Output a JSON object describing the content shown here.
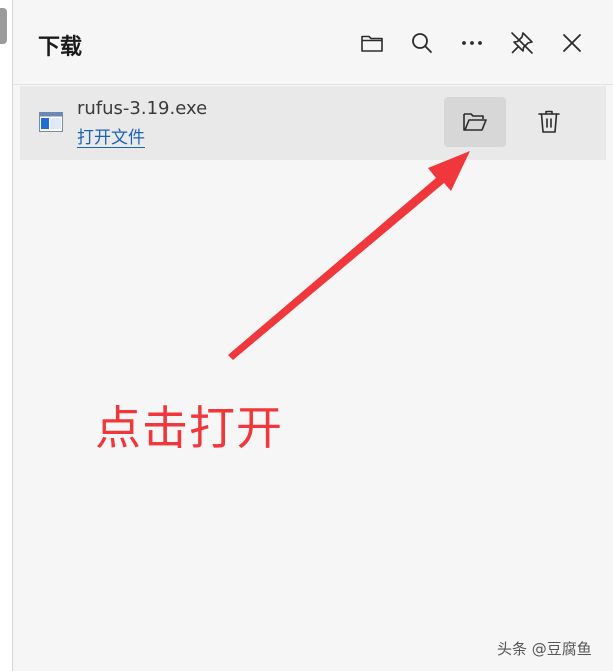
{
  "panel": {
    "title": "下载"
  },
  "header_icons": [
    "folder-icon",
    "search-icon",
    "more-icon",
    "unpin-icon",
    "close-icon"
  ],
  "download_item": {
    "file_name": "rufus-3.19.exe",
    "open_file_label": "打开文件",
    "icons": [
      "exe-file-icon",
      "folder-open-icon",
      "trash-icon"
    ]
  },
  "annotation": {
    "text": "点击打开",
    "color": "#f0373b"
  },
  "watermark": {
    "text": "头条 @豆腐鱼"
  },
  "colors": {
    "accent_link": "#1a62b8",
    "item_background": "#e9e9e9",
    "hover_button": "#d7d7d7"
  }
}
